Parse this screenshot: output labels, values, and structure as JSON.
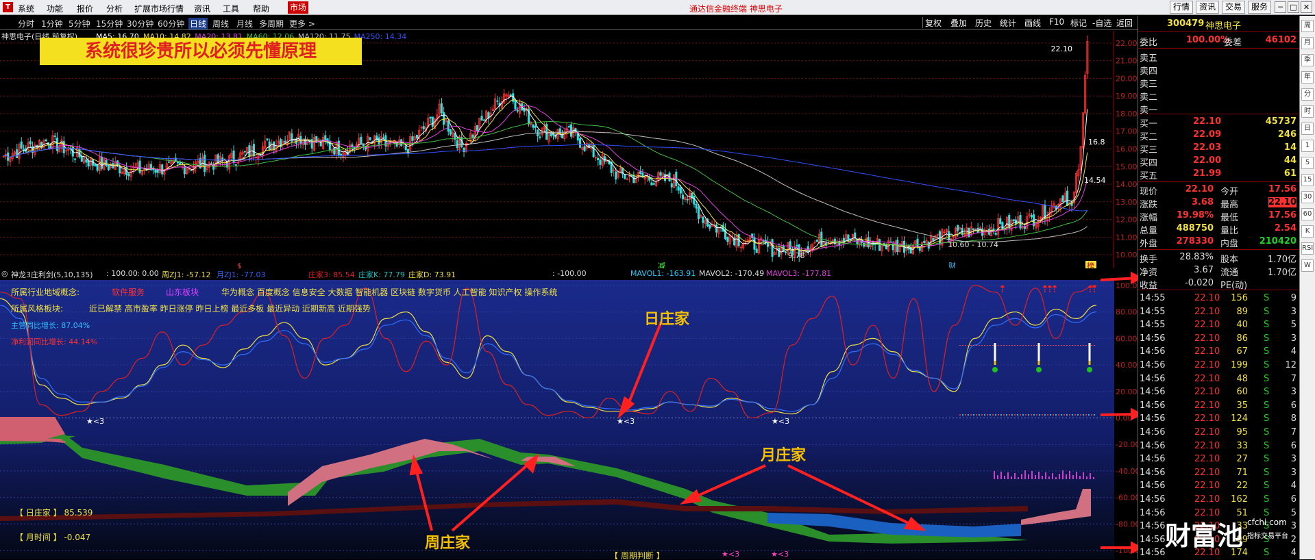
{
  "menubar": {
    "logo_icon": "app-logo-icon",
    "items": [
      "系统",
      "功能",
      "报价",
      "分析",
      "扩展市场行情",
      "资讯",
      "工具",
      "帮助"
    ],
    "highlight_item": "市场",
    "title": "通达信金融终端  神思电子",
    "right_buttons": [
      "行情",
      "资讯",
      "交易",
      "服务"
    ],
    "window_icons": [
      "minimize-icon",
      "maximize-icon",
      "close-icon"
    ]
  },
  "timeframes": {
    "items": [
      "分时",
      "1分钟",
      "5分钟",
      "15分钟",
      "30分钟",
      "60分钟",
      "日线",
      "周线",
      "月线",
      "多周期",
      "更多 >"
    ],
    "active": "日线"
  },
  "toolbar": {
    "items": [
      "复权",
      "叠加",
      "历史",
      "统计",
      "画线",
      "F10",
      "标记",
      "-自选",
      "返回"
    ]
  },
  "main_chart": {
    "title_prefix": "神思电子(日线,前复权)",
    "mas": [
      {
        "label": "MA5: 16.70",
        "color": "#ffffff"
      },
      {
        "label": "MA10: 14.82",
        "color": "#f0e040"
      },
      {
        "label": "MA20: 13.81",
        "color": "#e040e0"
      },
      {
        "label": "MA60: 12.06",
        "color": "#40c040"
      },
      {
        "label": "MA120: 11.75",
        "color": "#c0c0c0"
      },
      {
        "label": "MA250: 14.34",
        "color": "#3050ff"
      }
    ],
    "banner": "系统很珍贵所以必须先懂原理",
    "yticks": [
      "22.00",
      "21.00",
      "20.00",
      "19.00",
      "18.00",
      "17.00",
      "16.00",
      "15.00",
      "14.00",
      "13.00",
      "12.00",
      "11.00",
      "10.00"
    ],
    "annotations": [
      "22.10",
      "16.8",
      "14.54",
      "9.78",
      "10.60 - 10.74"
    ],
    "markers": [
      "$",
      "减",
      "财",
      "榜"
    ]
  },
  "chart_data": [
    {
      "type": "candlestick",
      "title": "神思电子(日线,前复权)",
      "ylim": [
        9.5,
        22.5
      ],
      "close_points": [
        {
          "i": 0,
          "v": 15.6
        },
        {
          "i": 20,
          "v": 16.5
        },
        {
          "i": 40,
          "v": 15.2
        },
        {
          "i": 60,
          "v": 14.8
        },
        {
          "i": 80,
          "v": 15.0
        },
        {
          "i": 100,
          "v": 15.3
        },
        {
          "i": 130,
          "v": 16.8
        },
        {
          "i": 150,
          "v": 16.0
        },
        {
          "i": 165,
          "v": 16.4
        },
        {
          "i": 180,
          "v": 16.0
        },
        {
          "i": 195,
          "v": 18.1
        },
        {
          "i": 205,
          "v": 16.1
        },
        {
          "i": 225,
          "v": 19.3
        },
        {
          "i": 240,
          "v": 17.0
        },
        {
          "i": 255,
          "v": 16.8
        },
        {
          "i": 275,
          "v": 14.5
        },
        {
          "i": 300,
          "v": 14.2
        },
        {
          "i": 315,
          "v": 11.8
        },
        {
          "i": 330,
          "v": 10.8
        },
        {
          "i": 345,
          "v": 10.3
        },
        {
          "i": 355,
          "v": 10.3
        },
        {
          "i": 370,
          "v": 11.0
        },
        {
          "i": 390,
          "v": 10.6
        },
        {
          "i": 405,
          "v": 10.5
        },
        {
          "i": 420,
          "v": 11.0
        },
        {
          "i": 440,
          "v": 11.5
        },
        {
          "i": 460,
          "v": 12.0
        },
        {
          "i": 470,
          "v": 12.8
        },
        {
          "i": 475,
          "v": 13.5
        },
        {
          "i": 478,
          "v": 12.6
        },
        {
          "i": 482,
          "v": 15.8
        },
        {
          "i": 485,
          "v": 22.1
        }
      ],
      "candles": 486
    },
    {
      "type": "line",
      "title": "神龙3庄利剑(5,10,135)",
      "ylim": [
        -100,
        100
      ],
      "yticks": [
        "100.00",
        "80.00",
        "60.00",
        "40.00",
        "20.00",
        "0.00",
        "-20.00",
        "-40.00",
        "-60.00",
        "-80.00",
        "-100.00"
      ],
      "series": [
        {
          "name": "周ZJ1",
          "color": "#f0e040",
          "values": [
            0.9,
            0.8,
            0.25,
            0.15,
            0.1,
            0.12,
            0.15,
            0.25,
            0.4,
            0.55,
            0.45,
            0.38,
            0.52,
            0.62,
            0.72,
            0.6,
            0.4,
            0.45,
            0.55,
            0.75,
            0.8,
            0.65,
            0.42,
            0.3,
            0.62,
            0.5,
            0.32,
            0.22,
            0.12,
            0.08,
            0.05,
            0.05,
            0.07,
            0.12,
            0.1,
            0.08,
            0.15,
            0.12,
            0.05,
            0.03,
            0.1,
            0.35,
            0.55,
            0.6,
            0.5,
            0.35,
            0.3,
            0.2,
            0.6,
            0.75,
            0.8,
            0.7,
            0.82,
            0.75,
            0.85
          ]
        },
        {
          "name": "月ZJ1",
          "color": "#3070ff",
          "values": [
            0.85,
            0.75,
            0.3,
            0.18,
            0.12,
            0.12,
            0.16,
            0.24,
            0.38,
            0.5,
            0.44,
            0.4,
            0.48,
            0.58,
            0.66,
            0.56,
            0.42,
            0.45,
            0.52,
            0.7,
            0.74,
            0.62,
            0.45,
            0.34,
            0.56,
            0.48,
            0.32,
            0.22,
            0.13,
            0.09,
            0.07,
            0.06,
            0.08,
            0.12,
            0.1,
            0.09,
            0.14,
            0.12,
            0.07,
            0.05,
            0.1,
            0.3,
            0.5,
            0.56,
            0.48,
            0.36,
            0.3,
            0.22,
            0.55,
            0.7,
            0.75,
            0.68,
            0.78,
            0.72,
            0.8
          ]
        },
        {
          "name": "庄家3",
          "color": "#e02020",
          "values": [
            0.95,
            0.9,
            0.1,
            0.02,
            0.05,
            0.2,
            0.3,
            0.45,
            0.65,
            0.4,
            0.55,
            0.7,
            0.8,
            0.95,
            0.62,
            0.3,
            0.6,
            0.7,
            0.98,
            0.6,
            0.35,
            0.58,
            0.4,
            0.98,
            0.5,
            0.25,
            0.1,
            0.02,
            0.05,
            0.0,
            0.15,
            0.05,
            0.03,
            0.2,
            0.05,
            0.3,
            0.2,
            0.0,
            0.04,
            0.55,
            0.75,
            0.92,
            0.4,
            0.7,
            0.3,
            0.9,
            0.2,
            0.7,
            1.0,
            0.95,
            0.7,
            0.98,
            0.6,
            0.95,
            1.0
          ]
        }
      ]
    }
  ],
  "sub_header": {
    "title": "神龙3庄利剑(5,10,135)",
    "items": [
      {
        "text": ": 100.00",
        "color": "#dddddd"
      },
      {
        "text": ": 0.00",
        "color": "#dddddd"
      },
      {
        "text": "周ZJ1: -57.12",
        "color": "#f0e040"
      },
      {
        "text": "月ZJ1: -77.03",
        "color": "#3060ff"
      },
      {
        "text": "庄家3: 85.54",
        "color": "#e02020"
      },
      {
        "text": "庄家K: 77.79",
        "color": "#20c0c0"
      },
      {
        "text": "庄家D: 73.91",
        "color": "#f0e040"
      },
      {
        "text": ": -100.00",
        "color": "#dddddd"
      },
      {
        "text": "MAVOL1: -163.91",
        "color": "#20d0ff"
      },
      {
        "text": "MAVOL2: -170.49",
        "color": "#dddddd"
      },
      {
        "text": "MAVOL3: -177.81",
        "color": "#e040e0"
      }
    ]
  },
  "indicator": {
    "concept_label": "所属行业地域概念:",
    "concepts": [
      {
        "text": "软件服务",
        "color": "#ff3030"
      },
      {
        "text": "山东板块",
        "color": "#e040ff"
      },
      {
        "text": "华为概念 百度概念 信息安全 大数据 智能机器 区块链 数字货币 人工智能 知识产权 操作系统",
        "color": "#f0e040"
      }
    ],
    "style_label": "所属风格板块:",
    "styles": "近已解禁 高市盈率 昨日涨停 昨日上榜 最近多板 最近异动 近期新高 近期强势",
    "revenue": "主营同比增长: 87.04%",
    "profit": "净利润同比增长: 44.14%",
    "star_labels": [
      "<3",
      "<3",
      "<3",
      "<3",
      "<3"
    ],
    "day_banker": "【 日庄家 】   85.539",
    "month_time": "【 月时间 】   -0.047",
    "cycle": "【 周期判断 】"
  },
  "overlays": {
    "day": "日庄家",
    "month": "月庄家",
    "week": "周庄家",
    "box100": "100",
    "box0": "0",
    "big100": "100",
    "box0b": "0"
  },
  "quote_panel": {
    "code": "300479",
    "name": "神思电子",
    "weibi_label": "委比",
    "weibi": "100.00%",
    "weicha_label": "委差",
    "weicha": "46102",
    "sells": [
      "卖五",
      "卖四",
      "卖三",
      "卖二",
      "卖一"
    ],
    "buys": [
      {
        "label": "买一",
        "price": "22.10",
        "vol": "45737"
      },
      {
        "label": "买二",
        "price": "22.09",
        "vol": "246"
      },
      {
        "label": "买三",
        "price": "22.03",
        "vol": "14"
      },
      {
        "label": "买四",
        "price": "22.00",
        "vol": "44"
      },
      {
        "label": "买五",
        "price": "21.99",
        "vol": "61"
      }
    ],
    "stats": [
      {
        "l1": "现价",
        "v1": "22.10",
        "c1": "#ff3030",
        "l2": "今开",
        "v2": "17.56",
        "c2": "#ff3030"
      },
      {
        "l1": "涨跌",
        "v1": "3.68",
        "c1": "#ff3030",
        "l2": "最高",
        "v2": "22.10",
        "c2": "#ff3030"
      },
      {
        "l1": "涨幅",
        "v1": "19.98%",
        "c1": "#ff3030",
        "l2": "最低",
        "v2": "17.56",
        "c2": "#ff3030"
      },
      {
        "l1": "总量",
        "v1": "488750",
        "c1": "#f0e040",
        "l2": "量比",
        "v2": "2.54",
        "c2": "#ff3030"
      },
      {
        "l1": "外盘",
        "v1": "278330",
        "c1": "#ff3030",
        "l2": "内盘",
        "v2": "210420",
        "c2": "#20d020"
      }
    ],
    "stats2": [
      {
        "l1": "换手",
        "v1": "28.83%",
        "l2": "股本",
        "v2": "1.70亿"
      },
      {
        "l1": "净资",
        "v1": "3.67",
        "l2": "流通",
        "v2": "1.70亿"
      },
      {
        "l1": "收益",
        "v1": "-0.020",
        "l2": "PE(动)",
        "v2": ""
      }
    ],
    "ticks": [
      {
        "t": "14:55",
        "p": "22.10",
        "v": "156",
        "s": "S",
        "n": "9"
      },
      {
        "t": "14:55",
        "p": "22.10",
        "v": "89",
        "s": "S",
        "n": "3"
      },
      {
        "t": "14:55",
        "p": "22.10",
        "v": "40",
        "s": "S",
        "n": "5"
      },
      {
        "t": "14:56",
        "p": "22.10",
        "v": "86",
        "s": "S",
        "n": "3"
      },
      {
        "t": "14:56",
        "p": "22.10",
        "v": "67",
        "s": "S",
        "n": "4"
      },
      {
        "t": "14:56",
        "p": "22.10",
        "v": "199",
        "s": "S",
        "n": "12"
      },
      {
        "t": "14:56",
        "p": "22.10",
        "v": "48",
        "s": "S",
        "n": "7"
      },
      {
        "t": "14:56",
        "p": "22.10",
        "v": "60",
        "s": "S",
        "n": "3"
      },
      {
        "t": "14:56",
        "p": "22.10",
        "v": "35",
        "s": "S",
        "n": "6"
      },
      {
        "t": "14:56",
        "p": "22.10",
        "v": "124",
        "s": "S",
        "n": "8"
      },
      {
        "t": "14:56",
        "p": "22.10",
        "v": "95",
        "s": "S",
        "n": "7"
      },
      {
        "t": "14:56",
        "p": "22.10",
        "v": "33",
        "s": "S",
        "n": "6"
      },
      {
        "t": "14:56",
        "p": "22.10",
        "v": "27",
        "s": "S",
        "n": "3"
      },
      {
        "t": "14:56",
        "p": "22.10",
        "v": "71",
        "s": "S",
        "n": "3"
      },
      {
        "t": "14:56",
        "p": "22.10",
        "v": "22",
        "s": "S",
        "n": "4"
      },
      {
        "t": "14:56",
        "p": "22.10",
        "v": "162",
        "s": "S",
        "n": "6"
      },
      {
        "t": "14:56",
        "p": "22.10",
        "v": "51",
        "s": "S",
        "n": "5"
      },
      {
        "t": "14:56",
        "p": "22.10",
        "v": "33",
        "s": "S",
        "n": "3"
      },
      {
        "t": "14:56",
        "p": "22.10",
        "v": "99",
        "s": "S",
        "n": "2"
      },
      {
        "t": "14:56",
        "p": "22.10",
        "v": "174",
        "s": "S",
        "n": "4"
      }
    ]
  },
  "watermark": {
    "name": "财富池",
    "url": "cfchi.com",
    "sub": "指标交易平台"
  },
  "side_tools": [
    "周",
    "月",
    "季",
    "年",
    "分",
    "时",
    "日",
    "1",
    "5",
    "15",
    "30",
    "60",
    "K",
    "RSI",
    "W"
  ]
}
